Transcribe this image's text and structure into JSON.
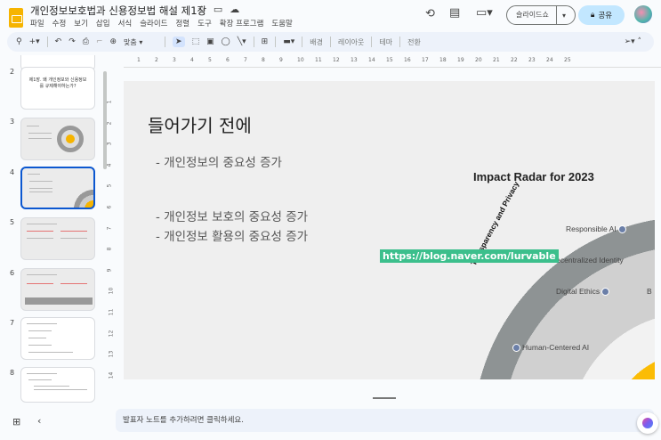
{
  "doc": {
    "title": "개인정보보호법과 신용정보법 해설 제1장"
  },
  "menu": [
    "파일",
    "수정",
    "보기",
    "삽입",
    "서식",
    "슬라이드",
    "정렬",
    "도구",
    "확장 프로그램",
    "도움말"
  ],
  "header": {
    "slideshow_label": "슬라이드쇼",
    "share_label": "공유"
  },
  "toolbar": {
    "zoom_label": "맞춤",
    "background": "배경",
    "layout": "레이아웃",
    "theme": "테마",
    "transition": "전환"
  },
  "filmstrip": [
    {
      "num": "2",
      "text": "제1장. 왜 개인정보와 신용정보를 규제해야하는가?"
    },
    {
      "num": "3"
    },
    {
      "num": "4"
    },
    {
      "num": "5"
    },
    {
      "num": "6"
    },
    {
      "num": "7"
    },
    {
      "num": "8"
    }
  ],
  "ruler": {
    "h": [
      "1",
      "2",
      "3",
      "4",
      "5",
      "6",
      "7",
      "8",
      "9",
      "10",
      "11",
      "12",
      "13",
      "14",
      "15",
      "16",
      "17",
      "18",
      "19",
      "20",
      "21",
      "22",
      "23",
      "24",
      "25"
    ],
    "v": [
      "1",
      "2",
      "3",
      "4",
      "5",
      "6",
      "7",
      "8",
      "9",
      "10",
      "11",
      "12",
      "13",
      "14"
    ]
  },
  "slide": {
    "title": "들어가기 전에",
    "bullets": [
      "-   개인정보의 중요성 증가",
      "-   개인정보 보호의 중요성 증가",
      "-   개인정보 활용의 중요성 증가"
    ],
    "radar_title": "Impact Radar for 2023",
    "arc_label": "Transparency and Privacy",
    "items": [
      "Responsible AI",
      "Decentralized Identity",
      "Digital Ethics",
      "Human-Centered AI",
      "B"
    ],
    "watermark": "https://blog.naver.com/lurvable"
  },
  "notes": {
    "placeholder": "발표자 노트를 추가하려면 클릭하세요."
  }
}
